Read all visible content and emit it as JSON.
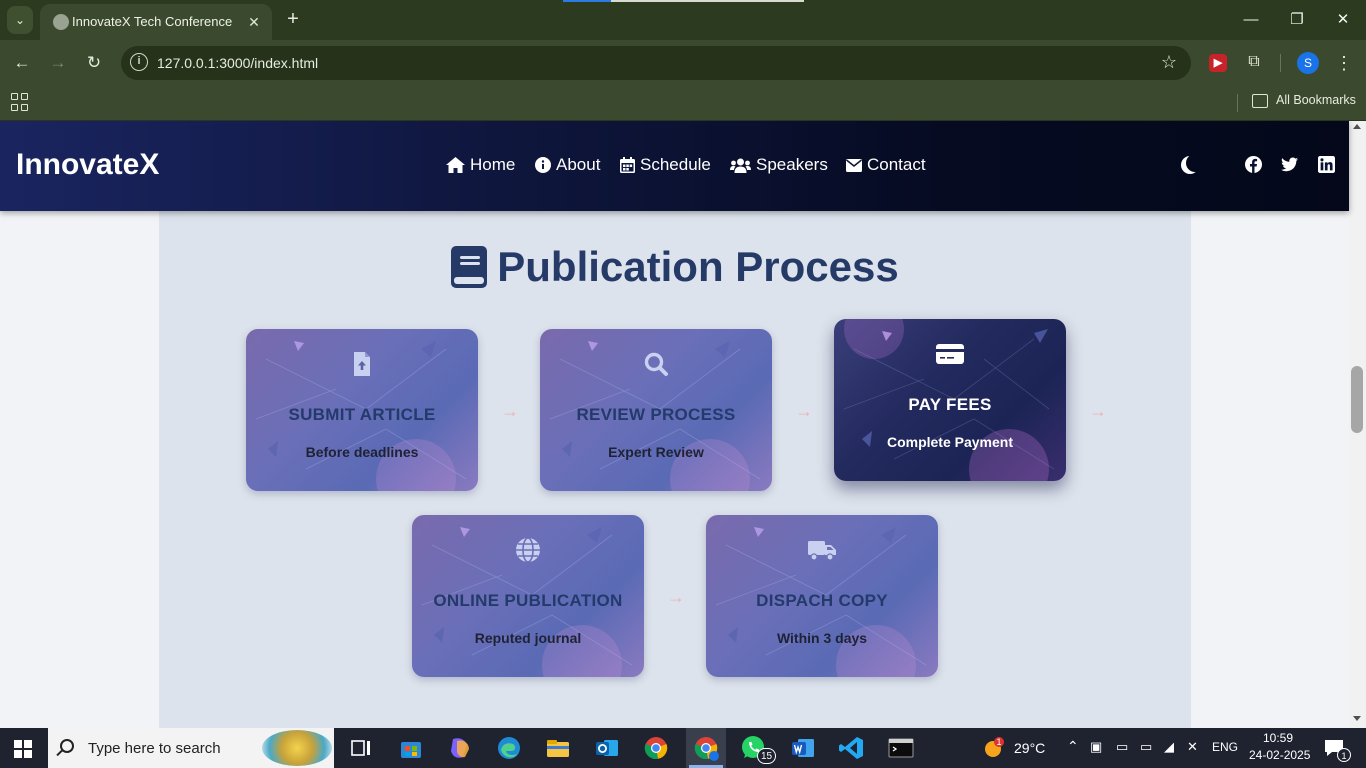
{
  "browser": {
    "tab_title": "InnovateX Tech Conference",
    "url": "127.0.0.1:3000/index.html",
    "bookmarks_label": "All Bookmarks",
    "profile_initial": "S"
  },
  "site": {
    "brand": "InnovateX",
    "nav": [
      {
        "label": "Home",
        "icon": "home-icon"
      },
      {
        "label": "About",
        "icon": "info-icon"
      },
      {
        "label": "Schedule",
        "icon": "calendar-icon"
      },
      {
        "label": "Speakers",
        "icon": "users-icon"
      },
      {
        "label": "Contact",
        "icon": "envelope-icon"
      }
    ],
    "social": [
      "facebook-icon",
      "twitter-icon",
      "linkedin-icon"
    ],
    "theme_toggle_icon": "moon-icon"
  },
  "section": {
    "title": "Publication Process",
    "title_icon": "book-icon",
    "steps": [
      {
        "title": "SUBMIT ARTICLE",
        "subtitle": "Before deadlines",
        "icon": "file-upload-icon"
      },
      {
        "title": "REVIEW PROCESS",
        "subtitle": "Expert Review",
        "icon": "search-icon"
      },
      {
        "title": "PAY FEES",
        "subtitle": "Complete Payment",
        "icon": "credit-card-icon",
        "active": true
      },
      {
        "title": "ONLINE PUBLICATION",
        "subtitle": "Reputed journal",
        "icon": "globe-icon"
      },
      {
        "title": "DISPACH COPY",
        "subtitle": "Within 3 days",
        "icon": "truck-icon"
      }
    ]
  },
  "colors": {
    "header_dark": "#060b22",
    "section_bg": "#dde3ec",
    "title_color": "#263a68",
    "card_purple": "#6a6fb8",
    "card_active": "#232a5e"
  },
  "taskbar": {
    "search_placeholder": "Type here to search",
    "weather": "29°C",
    "weather_badge": "1",
    "language": "ENG",
    "time": "10:59",
    "date": "24-02-2025",
    "whatsapp_badge": "15",
    "notification_badge": "1"
  }
}
